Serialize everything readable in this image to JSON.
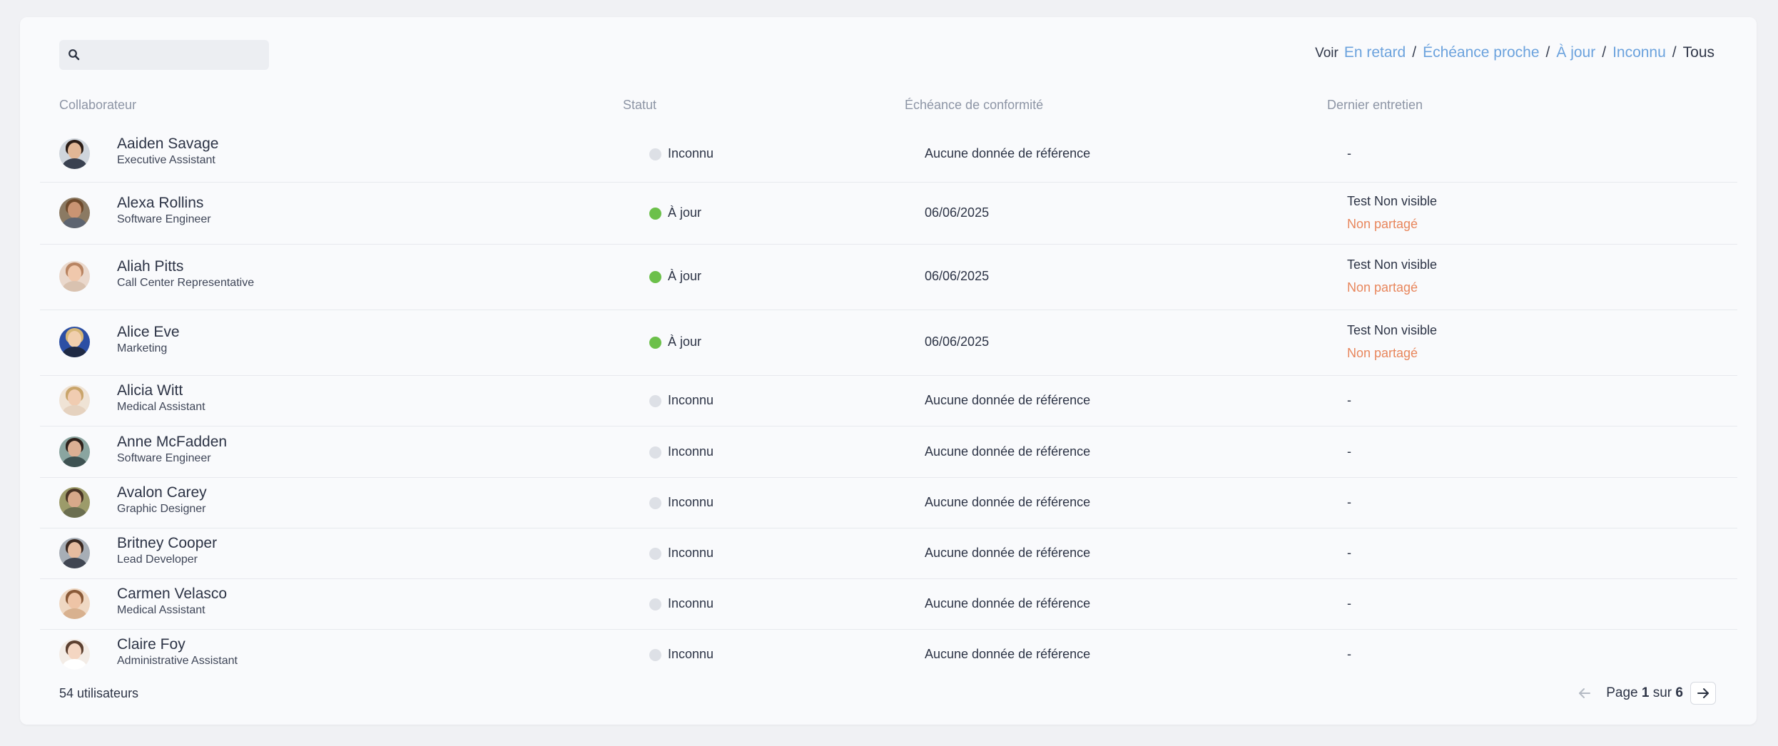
{
  "search": {
    "placeholder": "",
    "value": "",
    "icon": "search-icon"
  },
  "filters": {
    "label": "Voir",
    "options": [
      "En retard",
      "Échéance proche",
      "À jour",
      "Inconnu",
      "Tous"
    ],
    "active": "Tous",
    "separator": "/"
  },
  "columns": [
    "Collaborateur",
    "Statut",
    "Échéance de conformité",
    "Dernier entretien"
  ],
  "status_colors": {
    "Inconnu": "#dde0e6",
    "À jour": "#6cc04a"
  },
  "rows": [
    {
      "name": "Aaiden Savage",
      "role": "Executive Assistant",
      "status": "Inconnu",
      "deadline": "Aucune donnée de référence",
      "last": "-",
      "last_shared": ""
    },
    {
      "name": "Alexa Rollins",
      "role": "Software Engineer",
      "status": "À jour",
      "deadline": "06/06/2025",
      "last": "Test Non visible",
      "last_shared": "Non partagé"
    },
    {
      "name": "Aliah Pitts",
      "role": "Call Center Representative",
      "status": "À jour",
      "deadline": "06/06/2025",
      "last": "Test Non visible",
      "last_shared": "Non partagé"
    },
    {
      "name": "Alice Eve",
      "role": "Marketing",
      "status": "À jour",
      "deadline": "06/06/2025",
      "last": "Test Non visible",
      "last_shared": "Non partagé"
    },
    {
      "name": "Alicia Witt",
      "role": "Medical Assistant",
      "status": "Inconnu",
      "deadline": "Aucune donnée de référence",
      "last": "-",
      "last_shared": ""
    },
    {
      "name": "Anne McFadden",
      "role": "Software Engineer",
      "status": "Inconnu",
      "deadline": "Aucune donnée de référence",
      "last": "-",
      "last_shared": ""
    },
    {
      "name": "Avalon Carey",
      "role": "Graphic Designer",
      "status": "Inconnu",
      "deadline": "Aucune donnée de référence",
      "last": "-",
      "last_shared": ""
    },
    {
      "name": "Britney Cooper",
      "role": "Lead Developer",
      "status": "Inconnu",
      "deadline": "Aucune donnée de référence",
      "last": "-",
      "last_shared": ""
    },
    {
      "name": "Carmen Velasco",
      "role": "Medical Assistant",
      "status": "Inconnu",
      "deadline": "Aucune donnée de référence",
      "last": "-",
      "last_shared": ""
    },
    {
      "name": "Claire Foy",
      "role": "Administrative Assistant",
      "status": "Inconnu",
      "deadline": "Aucune donnée de référence",
      "last": "-",
      "last_shared": ""
    }
  ],
  "footer": {
    "count": "54 utilisateurs",
    "page_label": "Page",
    "page_current": "1",
    "page_of": "sur",
    "page_total": "6",
    "prev_icon": "arrow-left-icon",
    "next_icon": "arrow-right-icon"
  }
}
